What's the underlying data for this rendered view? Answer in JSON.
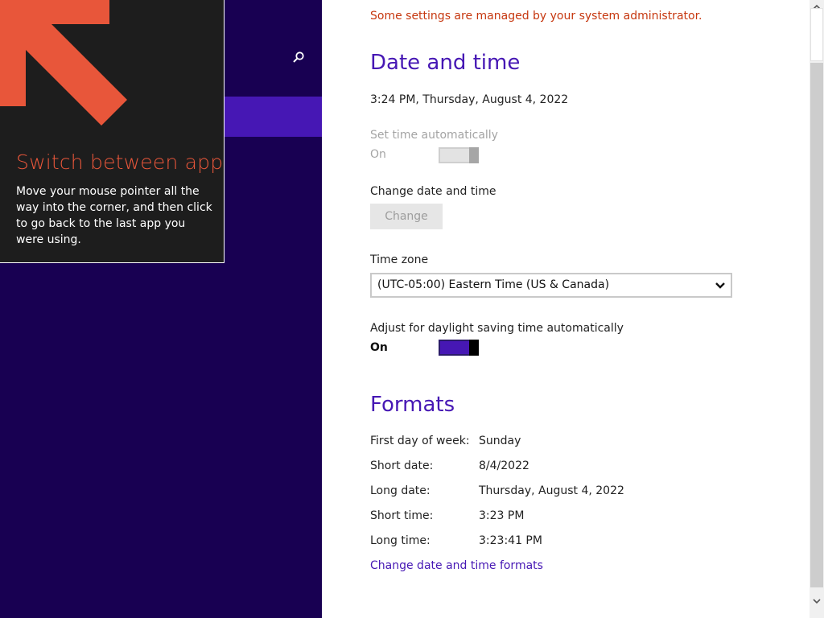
{
  "colors": {
    "nav_background": "#180052",
    "nav_selected": "#4617b4",
    "accent": "#4617b4",
    "admin_notice": "#c6370f",
    "tip_background": "#1d1d1d",
    "tip_accent": "#e8563a"
  },
  "nav": {
    "search_icon": "search-icon"
  },
  "tip": {
    "arrow_icon": "arrow-up-left-icon",
    "title": "Switch between apps",
    "body": "Move your mouse pointer all the way into the corner, and then click to go back to the last app you were using."
  },
  "content": {
    "admin_notice": "Some settings are managed by your system administrator.",
    "date_time_heading": "Date and time",
    "current_datetime": "3:24 PM, Thursday, August 4, 2022",
    "set_time_auto": {
      "label": "Set time automatically",
      "state": "On"
    },
    "change_date_time": {
      "label": "Change date and time",
      "button": "Change"
    },
    "time_zone": {
      "label": "Time zone",
      "selected": "(UTC-05:00) Eastern Time (US & Canada)"
    },
    "dst": {
      "label": "Adjust for daylight saving time automatically",
      "state": "On"
    },
    "formats_heading": "Formats",
    "formats": [
      {
        "label": "First day of week:",
        "value": "Sunday"
      },
      {
        "label": "Short date:",
        "value": "8/4/2022"
      },
      {
        "label": "Long date:",
        "value": "Thursday, August 4, 2022"
      },
      {
        "label": "Short time:",
        "value": "3:23 PM"
      },
      {
        "label": "Long time:",
        "value": "3:23:41 PM"
      }
    ],
    "change_formats_link": "Change date and time formats"
  }
}
